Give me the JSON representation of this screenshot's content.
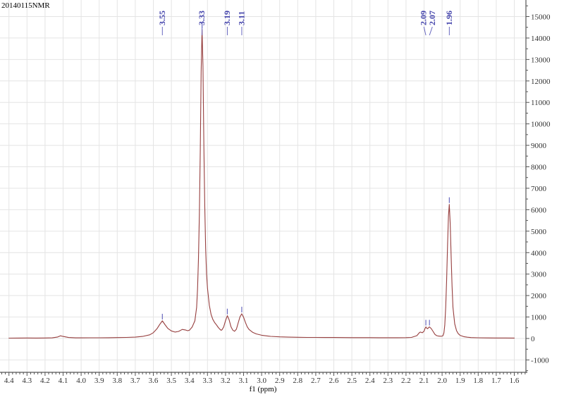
{
  "title": "20140115NMR",
  "colors": {
    "background": "#ffffff",
    "spectrum_line": "#963e3e",
    "peak_label": "#4343ab",
    "peak_leader": "#6868bf",
    "grid": "#e4e4e4",
    "axis": "#555555",
    "tick_text": "#333333"
  },
  "chart_data": {
    "type": "line",
    "title": "20140115NMR",
    "xlabel": "f1 (ppm)",
    "ylabel": "",
    "x_axis": {
      "reversed": true,
      "max": 4.4,
      "min": 1.6,
      "major_step": 0.1,
      "minor_step": 0.02,
      "tick_labels": [
        "4.4",
        "4.3",
        "4.2",
        "4.1",
        "4.0",
        "3.9",
        "3.8",
        "3.7",
        "3.6",
        "3.5",
        "3.4",
        "3.3",
        "3.2",
        "3.1",
        "3.0",
        "2.9",
        "2.8",
        "2.7",
        "2.6",
        "2.5",
        "2.4",
        "2.3",
        "2.2",
        "2.1",
        "2.0",
        "1.9",
        "1.8",
        "1.7",
        "1.6"
      ]
    },
    "y_axis": {
      "side": "right",
      "major_ticks": [
        15000,
        14000,
        13000,
        12000,
        11000,
        10000,
        9000,
        8000,
        7000,
        6000,
        5000,
        4000,
        3000,
        2000,
        1000,
        0,
        -1000
      ],
      "minor_step": 500,
      "minor_top": 15500,
      "minor_bottom": -1500,
      "ylim": [
        -1550,
        15800
      ]
    },
    "grid": {
      "horizontal_every": 1000,
      "vertical_every": 0.1
    },
    "peaks": [
      {
        "label": "3.55",
        "ppm": 3.55,
        "label_ppm": 3.55,
        "apex": 820
      },
      {
        "label": "3.33",
        "ppm": 3.33,
        "label_ppm": 3.33,
        "apex": 14400
      },
      {
        "label": "3.19",
        "ppm": 3.19,
        "label_ppm": 3.19,
        "apex": 1060
      },
      {
        "label": "3.11",
        "ppm": 3.11,
        "label_ppm": 3.11,
        "apex": 1150
      },
      {
        "label": "2.09",
        "ppm": 2.09,
        "label_ppm": 2.101,
        "apex": 540
      },
      {
        "label": "2.07",
        "ppm": 2.07,
        "label_ppm": 2.054,
        "apex": 540
      },
      {
        "label": "1.96",
        "ppm": 1.96,
        "label_ppm": 1.96,
        "apex": 6250
      }
    ],
    "points": [
      [
        4.4,
        18
      ],
      [
        4.35,
        20
      ],
      [
        4.3,
        22
      ],
      [
        4.25,
        20
      ],
      [
        4.2,
        22
      ],
      [
        4.16,
        28
      ],
      [
        4.13,
        70
      ],
      [
        4.115,
        125
      ],
      [
        4.1,
        95
      ],
      [
        4.07,
        45
      ],
      [
        4.03,
        30
      ],
      [
        4.0,
        30
      ],
      [
        3.95,
        32
      ],
      [
        3.9,
        34
      ],
      [
        3.85,
        36
      ],
      [
        3.8,
        42
      ],
      [
        3.75,
        48
      ],
      [
        3.7,
        62
      ],
      [
        3.66,
        95
      ],
      [
        3.62,
        170
      ],
      [
        3.6,
        270
      ],
      [
        3.58,
        450
      ],
      [
        3.565,
        650
      ],
      [
        3.55,
        820
      ],
      [
        3.535,
        640
      ],
      [
        3.52,
        470
      ],
      [
        3.5,
        350
      ],
      [
        3.48,
        300
      ],
      [
        3.46,
        330
      ],
      [
        3.44,
        420
      ],
      [
        3.42,
        390
      ],
      [
        3.41,
        360
      ],
      [
        3.4,
        385
      ],
      [
        3.385,
        530
      ],
      [
        3.37,
        820
      ],
      [
        3.36,
        1450
      ],
      [
        3.355,
        2300
      ],
      [
        3.35,
        3700
      ],
      [
        3.345,
        5800
      ],
      [
        3.34,
        8800
      ],
      [
        3.335,
        12400
      ],
      [
        3.33,
        14400
      ],
      [
        3.325,
        12700
      ],
      [
        3.32,
        8900
      ],
      [
        3.315,
        6100
      ],
      [
        3.31,
        4200
      ],
      [
        3.305,
        3000
      ],
      [
        3.3,
        2350
      ],
      [
        3.29,
        1550
      ],
      [
        3.28,
        1120
      ],
      [
        3.27,
        880
      ],
      [
        3.26,
        740
      ],
      [
        3.25,
        630
      ],
      [
        3.24,
        510
      ],
      [
        3.23,
        420
      ],
      [
        3.225,
        385
      ],
      [
        3.22,
        400
      ],
      [
        3.21,
        540
      ],
      [
        3.2,
        830
      ],
      [
        3.19,
        1060
      ],
      [
        3.18,
        870
      ],
      [
        3.17,
        550
      ],
      [
        3.16,
        390
      ],
      [
        3.15,
        335
      ],
      [
        3.14,
        430
      ],
      [
        3.13,
        720
      ],
      [
        3.12,
        1010
      ],
      [
        3.11,
        1150
      ],
      [
        3.1,
        990
      ],
      [
        3.09,
        750
      ],
      [
        3.08,
        550
      ],
      [
        3.07,
        420
      ],
      [
        3.05,
        290
      ],
      [
        3.03,
        215
      ],
      [
        3.0,
        150
      ],
      [
        2.95,
        100
      ],
      [
        2.9,
        75
      ],
      [
        2.85,
        62
      ],
      [
        2.8,
        55
      ],
      [
        2.75,
        50
      ],
      [
        2.7,
        48
      ],
      [
        2.65,
        46
      ],
      [
        2.6,
        45
      ],
      [
        2.55,
        42
      ],
      [
        2.5,
        40
      ],
      [
        2.45,
        40
      ],
      [
        2.4,
        38
      ],
      [
        2.35,
        37
      ],
      [
        2.3,
        36
      ],
      [
        2.25,
        36
      ],
      [
        2.2,
        38
      ],
      [
        2.17,
        48
      ],
      [
        2.14,
        130
      ],
      [
        2.125,
        280
      ],
      [
        2.12,
        300
      ],
      [
        2.11,
        265
      ],
      [
        2.1,
        340
      ],
      [
        2.095,
        460
      ],
      [
        2.09,
        540
      ],
      [
        2.085,
        480
      ],
      [
        2.08,
        455
      ],
      [
        2.075,
        505
      ],
      [
        2.07,
        540
      ],
      [
        2.06,
        460
      ],
      [
        2.05,
        330
      ],
      [
        2.04,
        190
      ],
      [
        2.03,
        130
      ],
      [
        2.02,
        112
      ],
      [
        2.01,
        105
      ],
      [
        2.0,
        110
      ],
      [
        1.995,
        135
      ],
      [
        1.99,
        270
      ],
      [
        1.985,
        620
      ],
      [
        1.98,
        1450
      ],
      [
        1.975,
        2700
      ],
      [
        1.97,
        4300
      ],
      [
        1.965,
        5700
      ],
      [
        1.96,
        6250
      ],
      [
        1.955,
        5350
      ],
      [
        1.95,
        3850
      ],
      [
        1.945,
        2450
      ],
      [
        1.94,
        1450
      ],
      [
        1.93,
        680
      ],
      [
        1.92,
        360
      ],
      [
        1.91,
        220
      ],
      [
        1.9,
        145
      ],
      [
        1.88,
        85
      ],
      [
        1.86,
        58
      ],
      [
        1.84,
        44
      ],
      [
        1.8,
        32
      ],
      [
        1.75,
        27
      ],
      [
        1.7,
        24
      ],
      [
        1.65,
        22
      ],
      [
        1.6,
        20
      ]
    ]
  }
}
